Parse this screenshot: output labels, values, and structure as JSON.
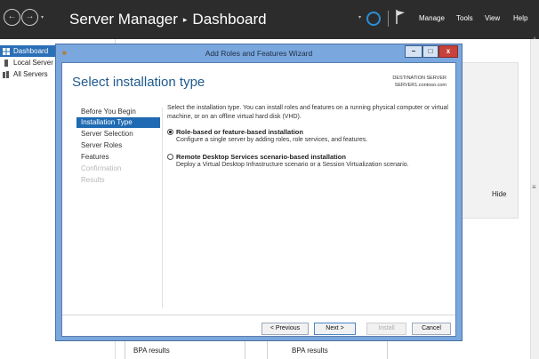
{
  "server_manager": {
    "title": "Server Manager",
    "breadcrumb_separator": "▸",
    "section": "Dashboard",
    "menu": [
      "Manage",
      "Tools",
      "View",
      "Help"
    ],
    "nav_back": "←",
    "nav_forward": "→",
    "nav_dropdown": "▾",
    "refresh_dropdown": "▾"
  },
  "sidebar": {
    "items": [
      {
        "label": "Dashboard",
        "icon": "dashboard-icon"
      },
      {
        "label": "Local Server",
        "icon": "server-icon"
      },
      {
        "label": "All Servers",
        "icon": "servers-icon"
      }
    ]
  },
  "dashboard": {
    "hide_label": "Hide",
    "grip": "≡",
    "scroll_up": "▲",
    "bpa_results": [
      "BPA results",
      "BPA results"
    ]
  },
  "wizard": {
    "window_title": "Add Roles and Features Wizard",
    "window_buttons": {
      "minimize": "–",
      "maximize": "□",
      "close": "x"
    },
    "heading": "Select installation type",
    "destination_label": "DESTINATION SERVER",
    "destination_server": "SERVER1.contoso.com",
    "steps": [
      {
        "label": "Before You Begin",
        "state": "normal"
      },
      {
        "label": "Installation Type",
        "state": "current"
      },
      {
        "label": "Server Selection",
        "state": "normal"
      },
      {
        "label": "Server Roles",
        "state": "normal"
      },
      {
        "label": "Features",
        "state": "normal"
      },
      {
        "label": "Confirmation",
        "state": "disabled"
      },
      {
        "label": "Results",
        "state": "disabled"
      }
    ],
    "intro": "Select the installation type. You can install roles and features on a running physical computer or virtual machine, or on an offline virtual hard disk (VHD).",
    "options": [
      {
        "title": "Role-based or feature-based installation",
        "description": "Configure a single server by adding roles, role services, and features.",
        "selected": true
      },
      {
        "title": "Remote Desktop Services scenario-based installation",
        "description": "Deploy a Virtual Desktop Infrastructure scenario or a Session Virtualization scenario.",
        "selected": false
      }
    ],
    "buttons": {
      "previous": "< Previous",
      "next": "Next >",
      "install": "Install",
      "cancel": "Cancel"
    }
  },
  "colors": {
    "header_bg": "#2c2c2c",
    "accent_blue": "#1f6ab3",
    "wizard_frame": "#7aa7dd",
    "close_red": "#c8413a"
  }
}
